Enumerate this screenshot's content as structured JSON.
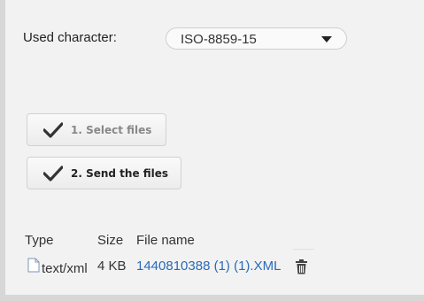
{
  "charset": {
    "label": "Used character:",
    "selected": "ISO-8859-15"
  },
  "steps": {
    "select_files": "1. Select files",
    "send_files": "2. Send the files"
  },
  "files_table": {
    "columns": [
      "Type",
      "Size",
      "File name"
    ],
    "rows": [
      {
        "type": "text/xml",
        "size": "4 KB",
        "name": "1440810388 (1) (1).XML"
      }
    ]
  },
  "icons": {
    "check": "check-icon",
    "file": "file-icon",
    "delete": "trash-icon",
    "dropdown": "chevron-down-icon"
  },
  "colors": {
    "link": "#2a6ab8",
    "panel": "#f2f2f2",
    "outer": "#d7d7d7"
  }
}
